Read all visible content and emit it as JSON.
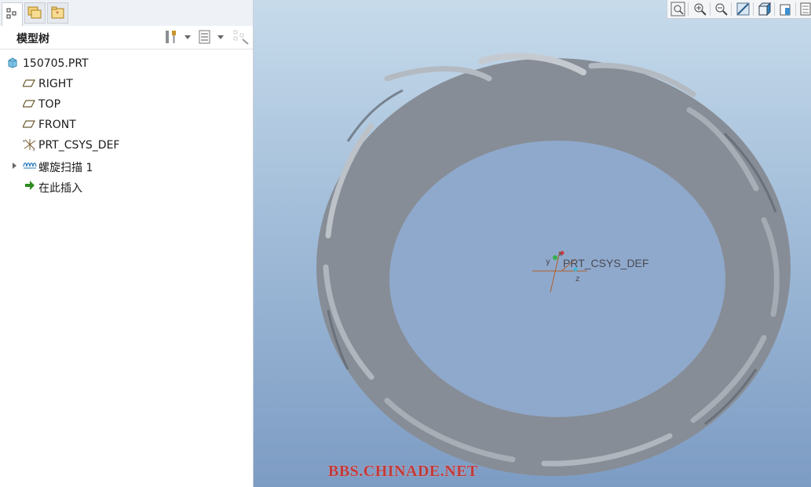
{
  "model_tree": {
    "title": "模型树",
    "root": "150705.PRT",
    "items": [
      {
        "label": "RIGHT",
        "icon": "datum-plane-icon"
      },
      {
        "label": "TOP",
        "icon": "datum-plane-icon"
      },
      {
        "label": "FRONT",
        "icon": "datum-plane-icon"
      },
      {
        "label": "PRT_CSYS_DEF",
        "icon": "coordinate-system-icon"
      },
      {
        "label": "螺旋扫描 1",
        "icon": "helical-sweep-icon"
      },
      {
        "label": "在此插入",
        "icon": "insert-here-arrow-icon"
      }
    ]
  },
  "viewport": {
    "csys_label": "PRT_CSYS_DEF",
    "axis_x": "x",
    "axis_y": "y",
    "axis_z": "z"
  },
  "watermark": "BBS.CHINADE.NET",
  "colors": {
    "model_gray": "#8a9099",
    "watermark_red": "#c13a3a",
    "insert_arrow_green": "#2e8b1e"
  }
}
